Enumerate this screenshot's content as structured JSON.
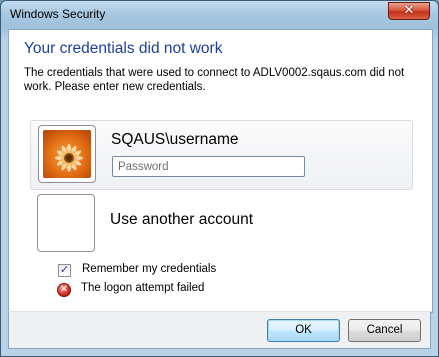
{
  "window": {
    "title": "Windows Security",
    "close_glyph": "✕"
  },
  "dialog": {
    "heading": "Your credentials did not work",
    "message": "The credentials that were used to connect to ADLV0002.sqaus.com did not work. Please enter new credentials."
  },
  "credential_tiles": {
    "selected": {
      "username": "SQAUS\\username",
      "avatar_icon": "flower-avatar-icon",
      "password": {
        "value": "",
        "placeholder": "Password"
      }
    },
    "other": {
      "label": "Use another account",
      "avatar_icon": "blank-avatar-icon"
    }
  },
  "options": {
    "remember": {
      "label": "Remember my credentials",
      "checked": true,
      "check_glyph": "✓"
    },
    "error": {
      "label": "The logon attempt failed",
      "icon": "error-icon",
      "glyph": "✕"
    }
  },
  "buttons": {
    "ok": "OK",
    "cancel": "Cancel"
  },
  "colors": {
    "heading": "#1c3f9e",
    "frame": "#a9c9e3",
    "close_button": "#c2331b",
    "default_button_border": "#3c7fb1"
  }
}
